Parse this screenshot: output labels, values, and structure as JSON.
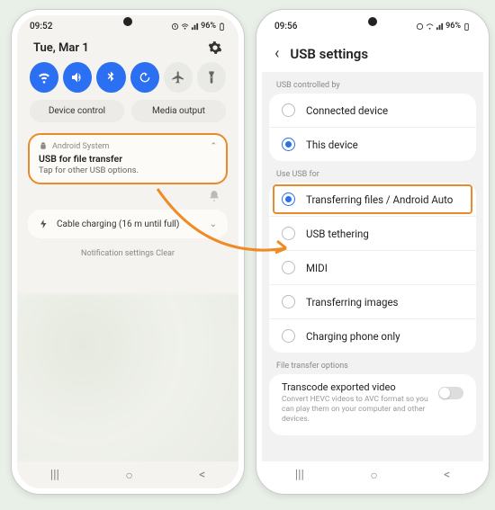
{
  "left": {
    "statusbar": {
      "time": "09:52",
      "battery": "96%"
    },
    "date": "Tue, Mar 1",
    "buttons": {
      "device_control": "Device control",
      "media_output": "Media output"
    },
    "notification": {
      "app": "Android System",
      "title": "USB for file transfer",
      "body": "Tap for other USB options."
    },
    "charging": "Cable charging (16 m until full)",
    "footer": "Notification settings       Clear"
  },
  "right": {
    "statusbar": {
      "time": "09:56",
      "battery": "96%"
    },
    "title": "USB settings",
    "section1_label": "USB controlled by",
    "controlled_by": {
      "connected": "Connected device",
      "this": "This device"
    },
    "section2_label": "Use USB for",
    "use_for": {
      "transfer": "Transferring files / Android Auto",
      "tether": "USB tethering",
      "midi": "MIDI",
      "images": "Transferring images",
      "charge": "Charging phone only"
    },
    "section3_label": "File transfer options",
    "transcode": {
      "title": "Transcode exported video",
      "desc": "Convert HEVC videos to AVC format so you can play them on your computer and other devices."
    }
  }
}
